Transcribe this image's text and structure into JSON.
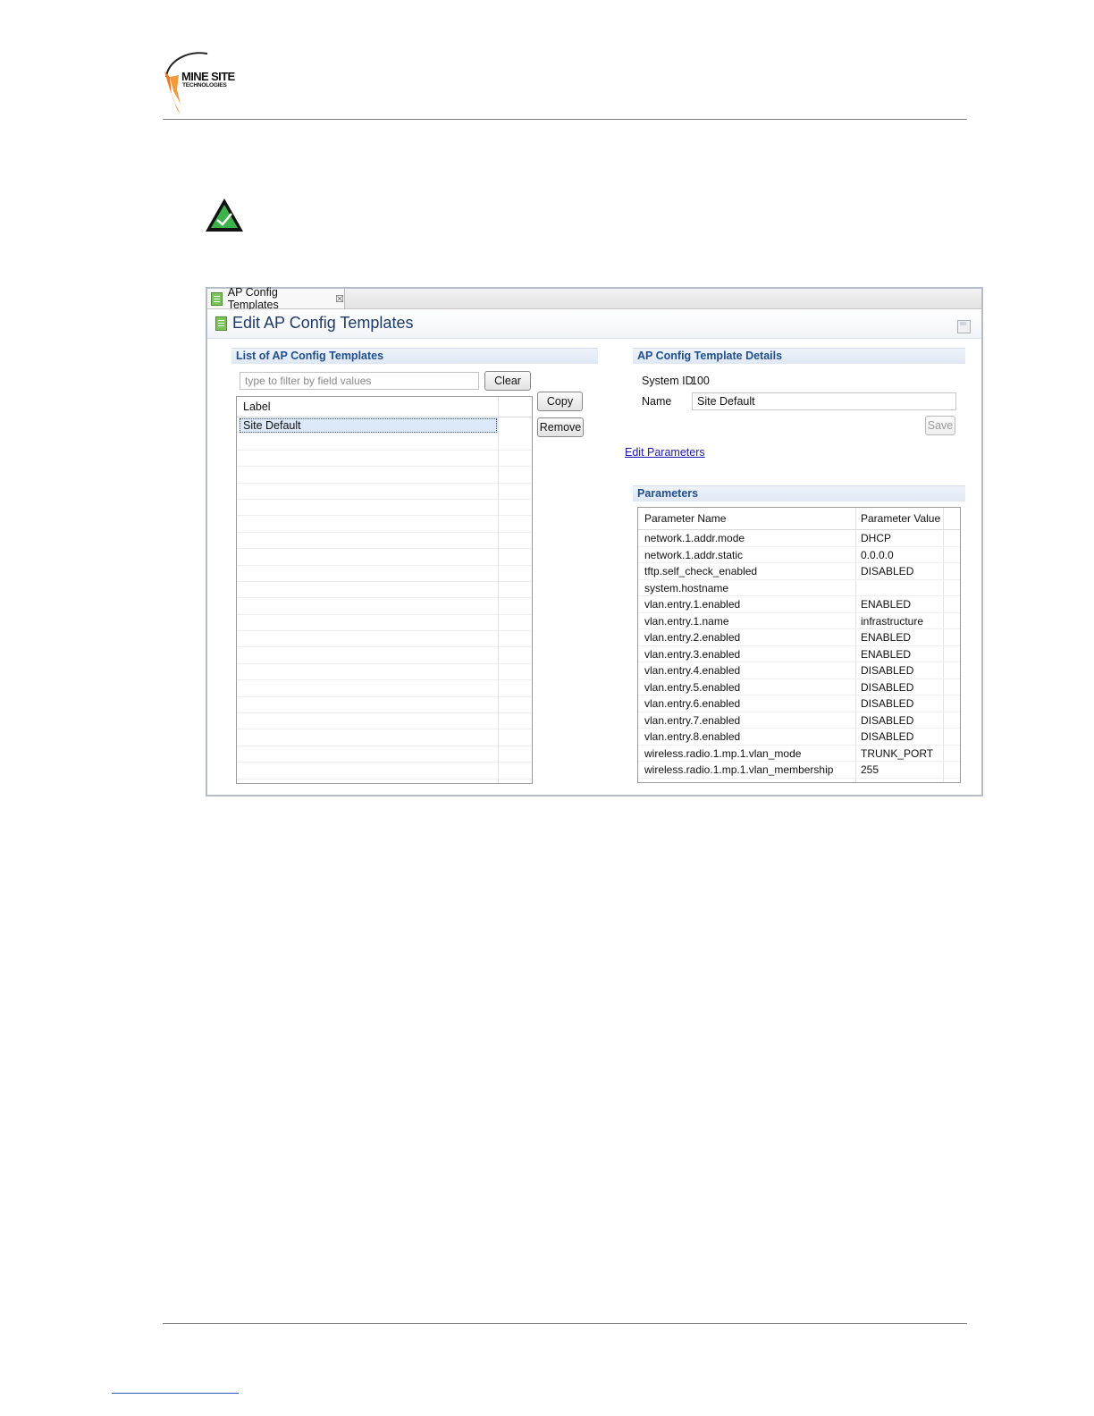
{
  "logo": {
    "line1": "MINE SITE",
    "line2": "TECHNOLOGIES"
  },
  "note_icon": "checkmark-warning-icon",
  "screenshot": {
    "tab": {
      "label": "AP Config Templates",
      "close_icon": "close-icon"
    },
    "editor_title": "Edit AP Config Templates",
    "list_section": {
      "heading": "List of AP Config Templates",
      "filter_placeholder": "type to filter by field values",
      "clear_label": "Clear",
      "copy_label": "Copy",
      "remove_label": "Remove",
      "column_header": "Label",
      "rows": [
        "Site Default"
      ]
    },
    "details_section": {
      "heading": "AP Config Template Details",
      "system_id_label": "System ID",
      "system_id_value": "100",
      "name_label": "Name",
      "name_value": "Site Default",
      "save_label": "Save",
      "edit_link": "Edit Parameters "
    },
    "parameters_section": {
      "heading": "Parameters",
      "columns": [
        "Parameter Name",
        "Parameter Value"
      ],
      "rows": [
        [
          "network.1.addr.mode",
          "DHCP"
        ],
        [
          "network.1.addr.static",
          "0.0.0.0"
        ],
        [
          "tftp.self_check_enabled",
          "DISABLED"
        ],
        [
          "system.hostname",
          ""
        ],
        [
          "vlan.entry.1.enabled",
          "ENABLED"
        ],
        [
          "vlan.entry.1.name",
          "infrastructure"
        ],
        [
          "vlan.entry.2.enabled",
          "ENABLED"
        ],
        [
          "vlan.entry.3.enabled",
          "ENABLED"
        ],
        [
          "vlan.entry.4.enabled",
          "DISABLED"
        ],
        [
          "vlan.entry.5.enabled",
          "DISABLED"
        ],
        [
          "vlan.entry.6.enabled",
          "DISABLED"
        ],
        [
          "vlan.entry.7.enabled",
          "DISABLED"
        ],
        [
          "vlan.entry.8.enabled",
          "DISABLED"
        ],
        [
          "wireless.radio.1.mp.1.vlan_mode",
          "TRUNK_PORT"
        ],
        [
          "wireless.radio.1.mp.1.vlan_membership",
          "255"
        ]
      ]
    }
  }
}
